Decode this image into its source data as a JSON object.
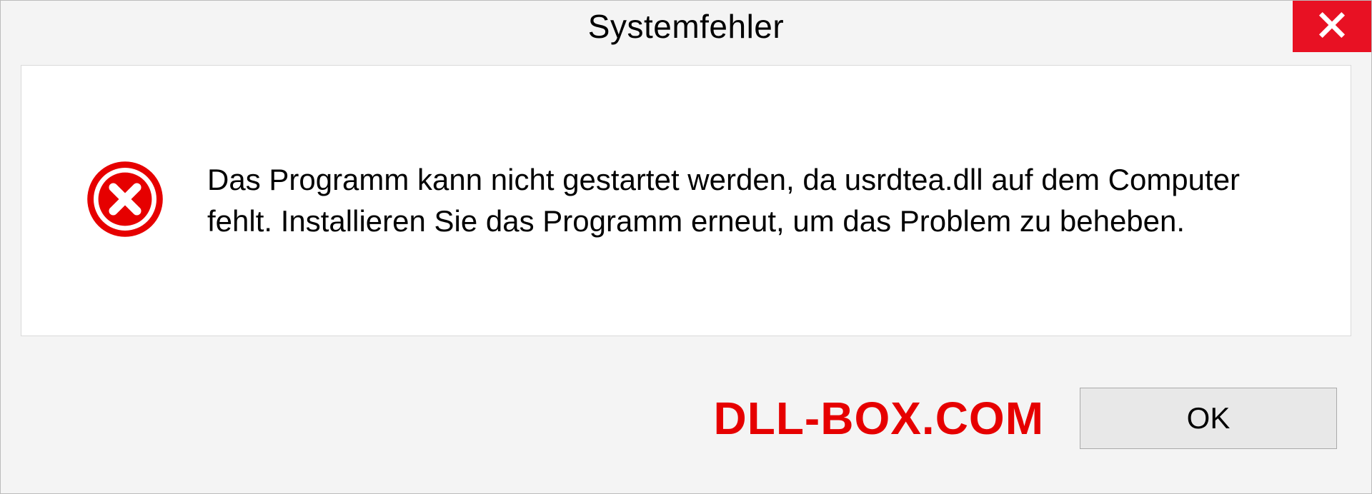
{
  "dialog": {
    "title": "Systemfehler",
    "message": "Das Programm kann nicht gestartet werden, da usrdtea.dll auf dem Computer fehlt. Installieren Sie das Programm erneut, um das Problem zu beheben.",
    "ok_label": "OK"
  },
  "watermark": "DLL-BOX.COM"
}
